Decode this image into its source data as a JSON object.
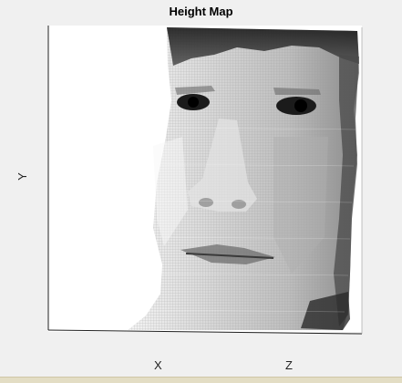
{
  "window": {
    "title": "Height Map"
  },
  "axes": {
    "xlabel": "X",
    "ylabel": "Y",
    "zlabel": "Z"
  },
  "surface": {
    "description_type": "3d-mesh-face-heightmap",
    "colormap": "gray"
  },
  "colors": {
    "figure_bg": "#f0f0f0",
    "axes_bg": "#ffffff",
    "status_strip": "#e3ddc4"
  }
}
